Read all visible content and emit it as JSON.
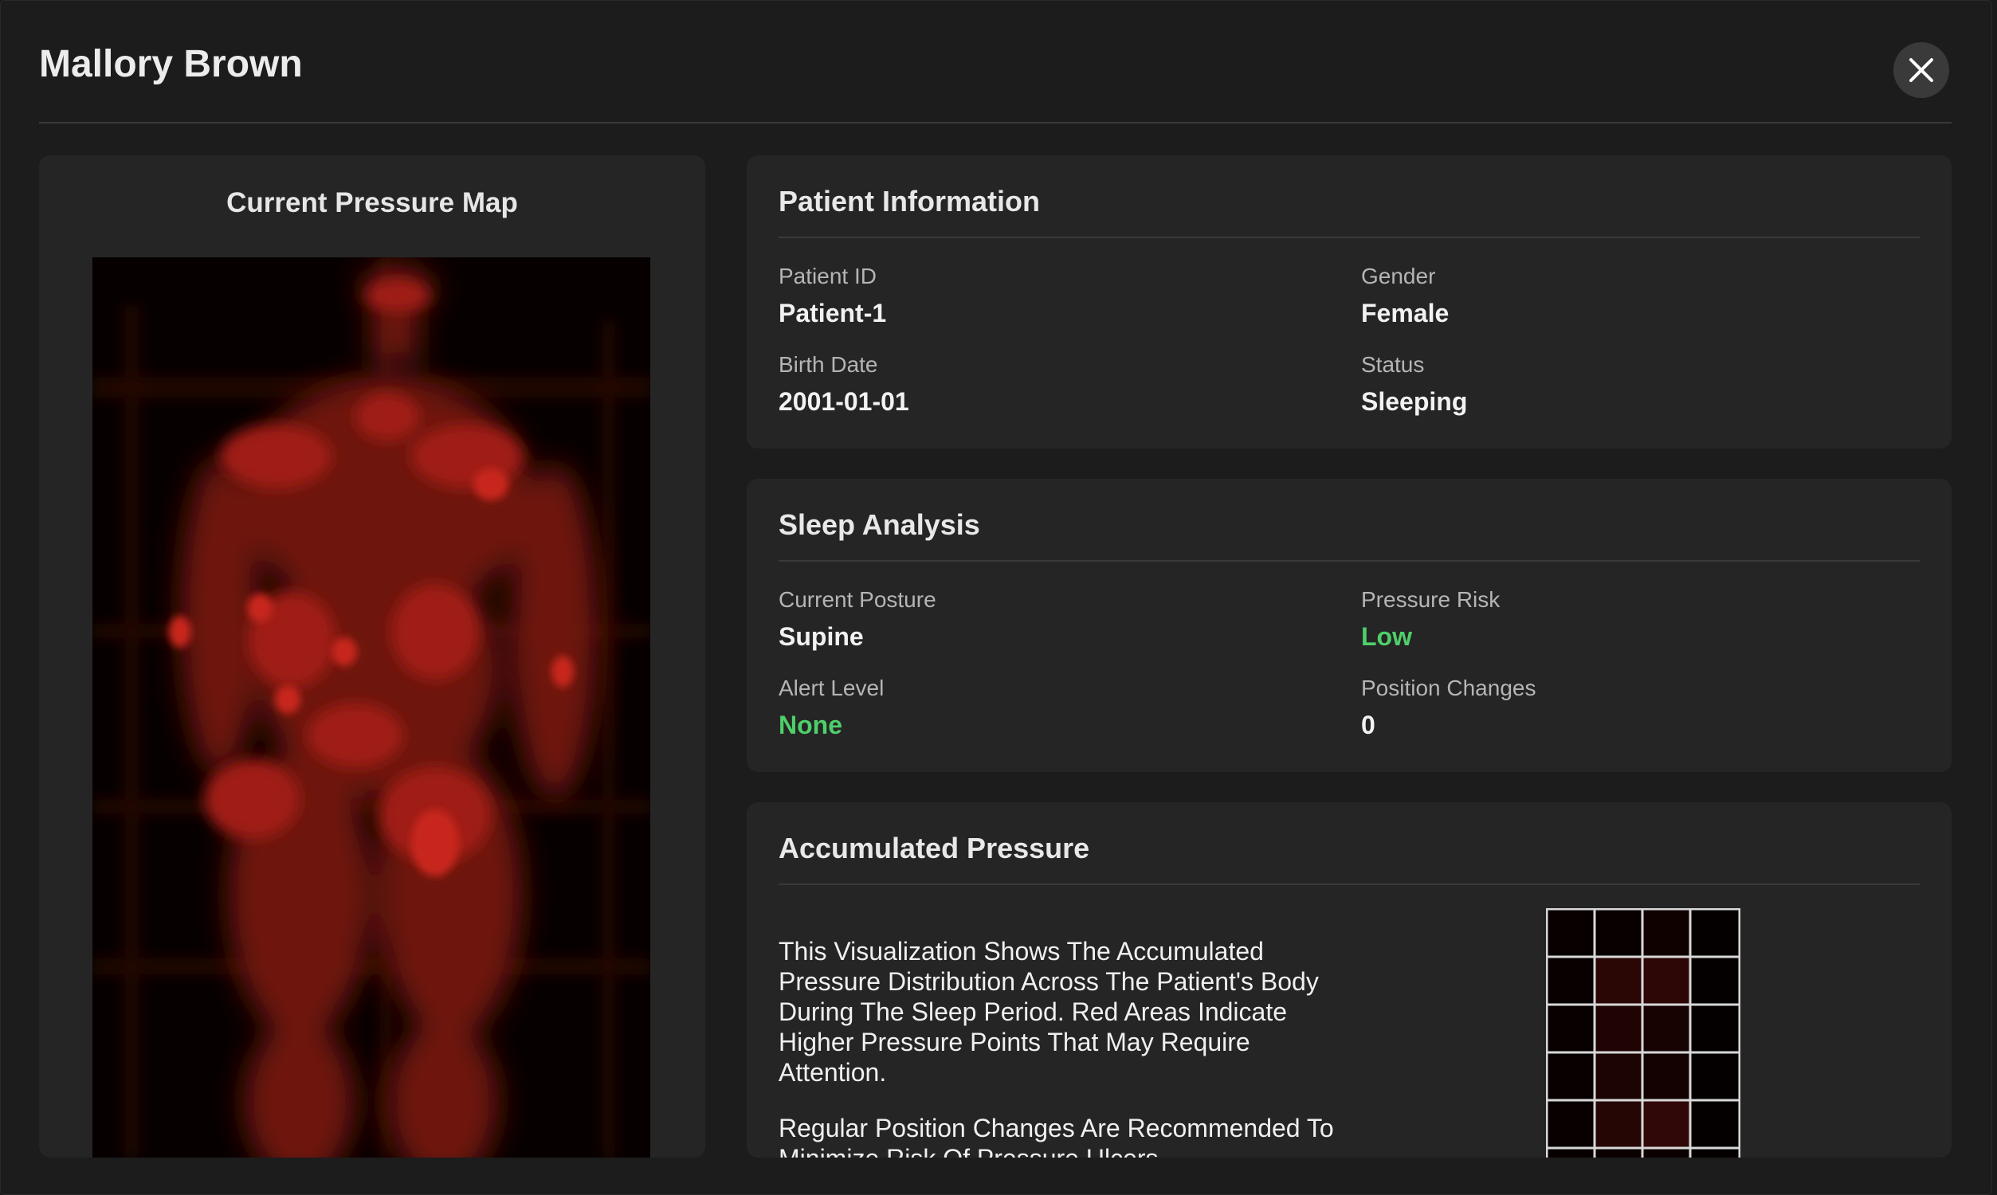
{
  "modal": {
    "title": "Mallory Brown",
    "close_icon": "close-icon"
  },
  "pressure_map": {
    "title": "Current Pressure Map"
  },
  "patient_info": {
    "title": "Patient Information",
    "fields": [
      {
        "label": "Patient ID",
        "value": "Patient-1"
      },
      {
        "label": "Gender",
        "value": "Female"
      },
      {
        "label": "Birth Date",
        "value": "2001-01-01"
      },
      {
        "label": "Status",
        "value": "Sleeping"
      }
    ]
  },
  "sleep_analysis": {
    "title": "Sleep Analysis",
    "fields": [
      {
        "label": "Current Posture",
        "value": "Supine"
      },
      {
        "label": "Pressure Risk",
        "value": "Low",
        "color": "#4fcf6a"
      },
      {
        "label": "Alert Level",
        "value": "None",
        "color": "#4fcf6a"
      },
      {
        "label": "Position Changes",
        "value": "0"
      }
    ]
  },
  "accumulated_pressure": {
    "title": "Accumulated Pressure",
    "paragraph_1": "This Visualization Shows The Accumulated Pressure Distribution Across The Patient's Body During The Sleep Period. Red Areas Indicate Higher Pressure Points That May Require Attention.",
    "paragraph_2": "Regular Position Changes Are Recommended To Minimize Risk Of Pressure Ulcers."
  },
  "colors": {
    "background": "#1c1c1c",
    "card": "#252525",
    "accent_green": "#4fcf6a",
    "pressure_red": "#c0201a"
  }
}
